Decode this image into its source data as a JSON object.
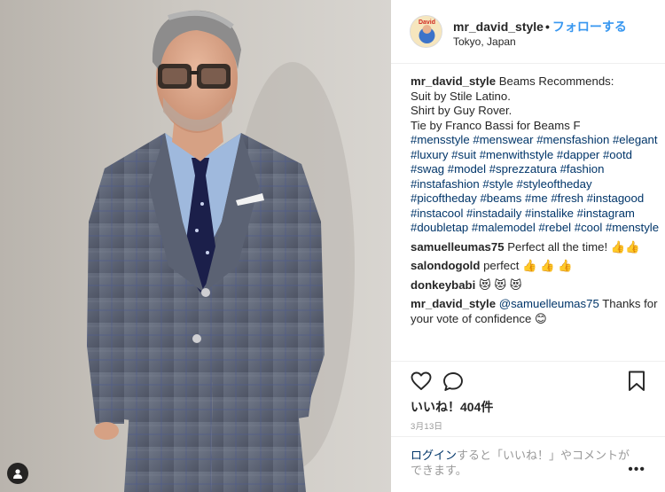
{
  "post": {
    "username": "mr_david_style",
    "dot": "•",
    "follow_label": "フォローする",
    "location": "Tokyo, Japan",
    "avatar_text": "David"
  },
  "comments": [
    {
      "user": "mr_david_style",
      "text": "Beams Recommends:",
      "lines": [
        "Suit by Stile Latino.",
        "Shirt by Guy Rover.",
        "Tie by Franco Bassi for Beams F"
      ],
      "hashtags": "#mensstyle #menswear #mensfashion #elegant #luxury #suit #menwithstyle #dapper #ootd #swag #model #sprezzatura #fashion #instafashion #style #styleoftheday #picoftheday #beams #me #fresh #instagood #instacool #instadaily #instalike #instagram #doubletap #malemodel #rebel #cool #menstyle"
    },
    {
      "user": "samuelleumas75",
      "text": "Perfect all the time! 👍👍"
    },
    {
      "user": "salondogold",
      "text": "perfect 👍 👍 👍"
    },
    {
      "user": "donkeybabi",
      "text": "😻 😻 😻"
    },
    {
      "user": "mr_david_style",
      "mention": "@samuelleumas75",
      "text": "Thanks for your vote of confidence 😊"
    }
  ],
  "actions": {
    "likes": "いいね！404件",
    "date": "3月13日"
  },
  "login": {
    "link": "ログイン",
    "text": "すると「いいね！」やコメントができます。",
    "more": "•••"
  },
  "icons": {
    "heart": "heart-icon",
    "comment": "comment-icon",
    "bookmark": "bookmark-icon",
    "tag": "person-tag-icon",
    "more": "more-options-icon"
  },
  "colors": {
    "link_blue": "#3897f0",
    "hashtag": "#003569",
    "text": "#262626",
    "muted": "#999999"
  }
}
